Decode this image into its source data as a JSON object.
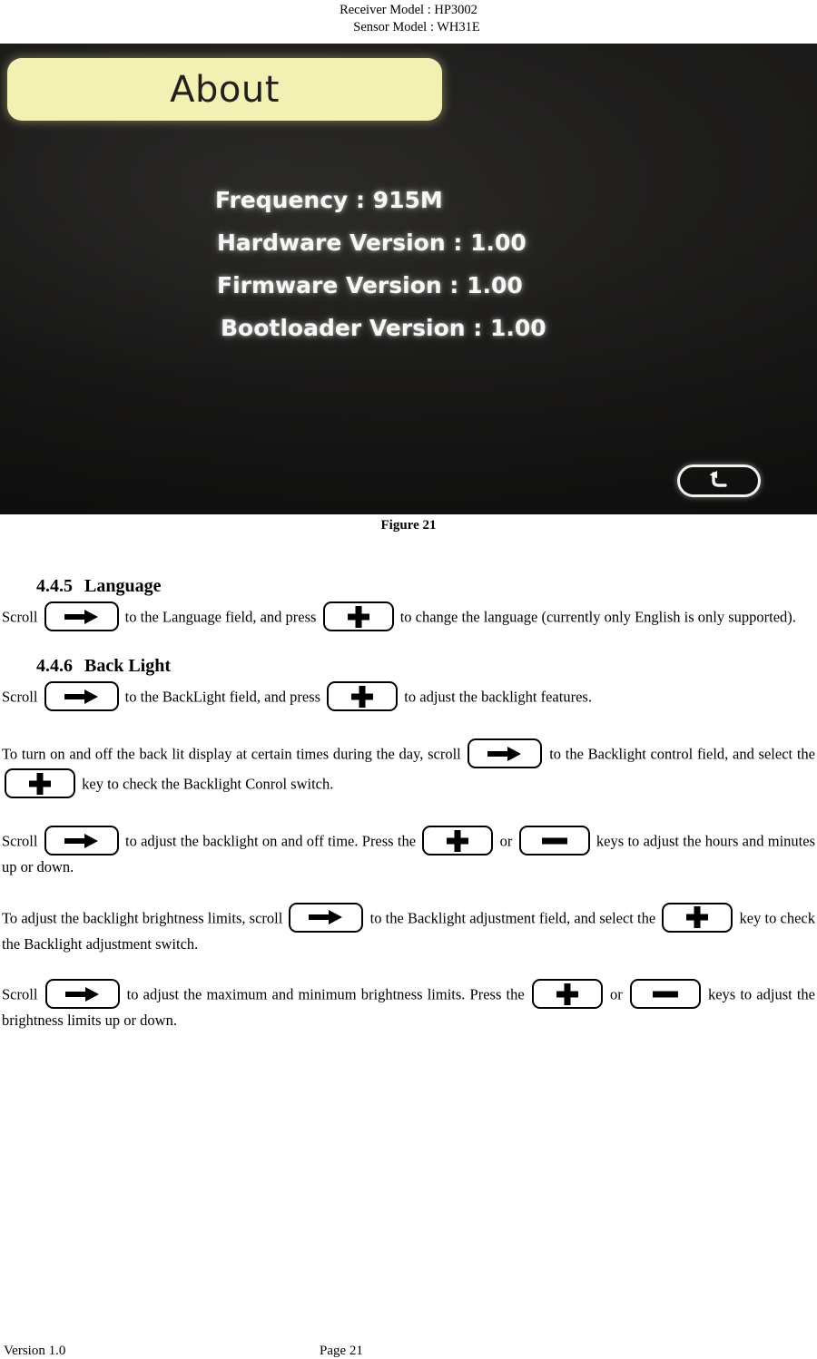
{
  "header": {
    "receiver_model": "Receiver Model : HP3002",
    "sensor_model": "Sensor Model : WH31E"
  },
  "figure": {
    "caption": "Figure 21",
    "screen": {
      "title": "About",
      "info_lines": [
        "Frequency : 915M",
        "Hardware Version : 1.00",
        "Firmware Version : 1.00",
        "Bootloader Version : 1.00"
      ],
      "back_button_icon": "back-arrow-icon"
    }
  },
  "sections": [
    {
      "number": "4.4.5",
      "title": "Language",
      "paragraphs": [
        {
          "parts": [
            {
              "type": "text",
              "value": "Scroll "
            },
            {
              "type": "key",
              "icon": "arrow-right-key-icon"
            },
            {
              "type": "text",
              "value": " to the Language field, and press "
            },
            {
              "type": "key",
              "icon": "plus-key-icon"
            },
            {
              "type": "text",
              "value": " to change the language (currently only English is only supported)."
            }
          ]
        }
      ]
    },
    {
      "number": "4.4.6",
      "title": "Back Light",
      "paragraphs": [
        {
          "parts": [
            {
              "type": "text",
              "value": "Scroll "
            },
            {
              "type": "key",
              "icon": "arrow-right-key-icon"
            },
            {
              "type": "text",
              "value": " to the BackLight field, and press "
            },
            {
              "type": "key",
              "icon": "plus-key-icon"
            },
            {
              "type": "text",
              "value": " to adjust the backlight features."
            }
          ]
        },
        {
          "parts": [
            {
              "type": "text",
              "value": "To turn on and off the back lit display at certain times during the day, scroll "
            },
            {
              "type": "key",
              "icon": "arrow-right-key-icon"
            },
            {
              "type": "text",
              "value": " to the Backlight control field, and select the "
            },
            {
              "type": "key",
              "icon": "plus-key-icon"
            },
            {
              "type": "text",
              "value": " key to check the Backlight Conrol switch."
            }
          ]
        },
        {
          "parts": [
            {
              "type": "text",
              "value": "Scroll "
            },
            {
              "type": "key",
              "icon": "arrow-right-key-icon"
            },
            {
              "type": "text",
              "value": " to adjust the backlight on and off time. Press the "
            },
            {
              "type": "key",
              "icon": "plus-key-icon"
            },
            {
              "type": "text",
              "value": " or "
            },
            {
              "type": "key",
              "icon": "minus-key-icon"
            },
            {
              "type": "text",
              "value": " keys to adjust the hours and minutes up or down."
            }
          ]
        },
        {
          "parts": [
            {
              "type": "text",
              "value": "To adjust the backlight brightness limits, scroll "
            },
            {
              "type": "key",
              "icon": "arrow-right-key-icon"
            },
            {
              "type": "text",
              "value": " to the Backlight adjustment field, and select the "
            },
            {
              "type": "key",
              "icon": "plus-key-icon"
            },
            {
              "type": "text",
              "value": " key to check the Backlight adjustment switch."
            }
          ]
        },
        {
          "parts": [
            {
              "type": "text",
              "value": "Scroll "
            },
            {
              "type": "key",
              "icon": "arrow-right-key-icon"
            },
            {
              "type": "text",
              "value": " to adjust the maximum and minimum brightness limits. Press the "
            },
            {
              "type": "key",
              "icon": "plus-key-icon"
            },
            {
              "type": "text",
              "value": " or "
            },
            {
              "type": "key",
              "icon": "minus-key-icon"
            },
            {
              "type": "text",
              "value": " keys to adjust the brightness limits up or down."
            }
          ]
        }
      ]
    }
  ],
  "footer": {
    "version": "Version 1.0",
    "page": "Page 21"
  },
  "colors": {
    "screen_background": "#1b1a19",
    "title_bar": "#f3f0b4",
    "screen_text": "#f7f7f5",
    "page_background": "#ffffff",
    "ink": "#000000"
  }
}
